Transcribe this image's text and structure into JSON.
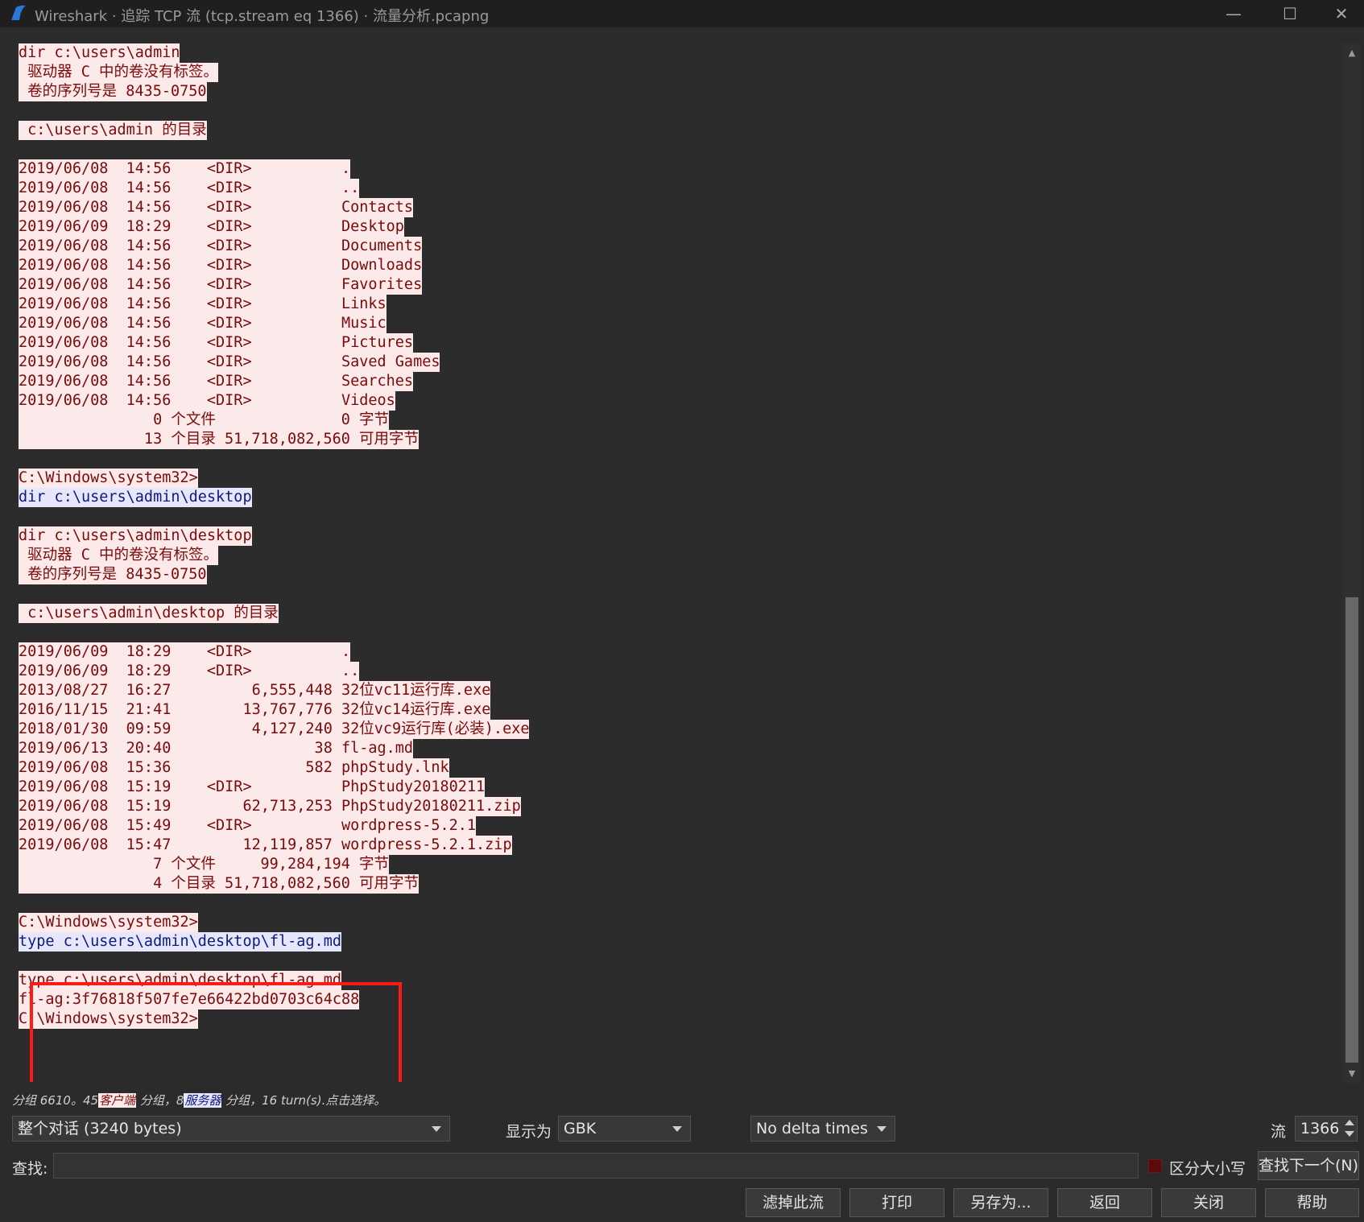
{
  "window": {
    "title": "Wireshark · 追踪 TCP 流 (tcp.stream eq 1366) · 流量分析.pcapng",
    "app_icon": "wireshark-fin-icon",
    "controls": [
      "minimize-icon",
      "maximize-icon",
      "close-icon"
    ]
  },
  "stream": {
    "lines": [
      [
        {
          "role": "client",
          "text": "dir c:\\users\\admin"
        }
      ],
      [
        {
          "role": "client",
          "text": " 驱动器 C 中的卷没有标签。"
        }
      ],
      [
        {
          "role": "client",
          "text": " 卷的序列号是 8435-0750"
        }
      ],
      [],
      [
        {
          "role": "client",
          "text": " c:\\users\\admin 的目录"
        }
      ],
      [],
      [
        {
          "role": "client",
          "text": "2019/06/08  14:56    <DIR>          ."
        }
      ],
      [
        {
          "role": "client",
          "text": "2019/06/08  14:56    <DIR>          .."
        }
      ],
      [
        {
          "role": "client",
          "text": "2019/06/08  14:56    <DIR>          Contacts"
        }
      ],
      [
        {
          "role": "client",
          "text": "2019/06/09  18:29    <DIR>          Desktop"
        }
      ],
      [
        {
          "role": "client",
          "text": "2019/06/08  14:56    <DIR>          Documents"
        }
      ],
      [
        {
          "role": "client",
          "text": "2019/06/08  14:56    <DIR>          Downloads"
        }
      ],
      [
        {
          "role": "client",
          "text": "2019/06/08  14:56    <DIR>          Favorites"
        }
      ],
      [
        {
          "role": "client",
          "text": "2019/06/08  14:56    <DIR>          Links"
        }
      ],
      [
        {
          "role": "client",
          "text": "2019/06/08  14:56    <DIR>          Music"
        }
      ],
      [
        {
          "role": "client",
          "text": "2019/06/08  14:56    <DIR>          Pictures"
        }
      ],
      [
        {
          "role": "client",
          "text": "2019/06/08  14:56    <DIR>          Saved Games"
        }
      ],
      [
        {
          "role": "client",
          "text": "2019/06/08  14:56    <DIR>          Searches"
        }
      ],
      [
        {
          "role": "client",
          "text": "2019/06/08  14:56    <DIR>          Videos"
        }
      ],
      [
        {
          "role": "client",
          "text": "               0 个文件              0 字节"
        }
      ],
      [
        {
          "role": "client",
          "text": "              13 个目录 51,718,082,560 可用字节"
        }
      ],
      [],
      [
        {
          "role": "client",
          "text": "C:\\Windows\\system32>"
        }
      ],
      [
        {
          "role": "server",
          "text": "dir c:\\users\\admin\\desktop"
        }
      ],
      [],
      [
        {
          "role": "client",
          "text": "dir c:\\users\\admin\\desktop"
        }
      ],
      [
        {
          "role": "client",
          "text": " 驱动器 C 中的卷没有标签。"
        }
      ],
      [
        {
          "role": "client",
          "text": " 卷的序列号是 8435-0750"
        }
      ],
      [],
      [
        {
          "role": "client",
          "text": " c:\\users\\admin\\desktop 的目录"
        }
      ],
      [],
      [
        {
          "role": "client",
          "text": "2019/06/09  18:29    <DIR>          ."
        }
      ],
      [
        {
          "role": "client",
          "text": "2019/06/09  18:29    <DIR>          .."
        }
      ],
      [
        {
          "role": "client",
          "text": "2013/08/27  16:27         6,555,448 32位vc11运行库.exe"
        }
      ],
      [
        {
          "role": "client",
          "text": "2016/11/15  21:41        13,767,776 32位vc14运行库.exe"
        }
      ],
      [
        {
          "role": "client",
          "text": "2018/01/30  09:59         4,127,240 32位vc9运行库(必装).exe"
        }
      ],
      [
        {
          "role": "client",
          "text": "2019/06/13  20:40                38 fl-ag.md"
        }
      ],
      [
        {
          "role": "client",
          "text": "2019/06/08  15:36               582 phpStudy.lnk"
        }
      ],
      [
        {
          "role": "client",
          "text": "2019/06/08  15:19    <DIR>          PhpStudy20180211"
        }
      ],
      [
        {
          "role": "client",
          "text": "2019/06/08  15:19        62,713,253 PhpStudy20180211.zip"
        }
      ],
      [
        {
          "role": "client",
          "text": "2019/06/08  15:49    <DIR>          wordpress-5.2.1"
        }
      ],
      [
        {
          "role": "client",
          "text": "2019/06/08  15:47        12,119,857 wordpress-5.2.1.zip"
        }
      ],
      [
        {
          "role": "client",
          "text": "               7 个文件     99,284,194 字节"
        }
      ],
      [
        {
          "role": "client",
          "text": "               4 个目录 51,718,082,560 可用字节"
        }
      ],
      [],
      [
        {
          "role": "client",
          "text": "C:\\Windows\\system32>"
        }
      ],
      [
        {
          "role": "server",
          "text": "type c:\\users\\admin\\desktop\\fl-ag.md"
        }
      ],
      [],
      [
        {
          "role": "client",
          "text": "type c:\\users\\admin\\desktop\\fl-ag.md"
        }
      ],
      [
        {
          "role": "client",
          "text": "fl-ag:3f76818f507fe7e66422bd0703c64c88"
        }
      ],
      [
        {
          "role": "client",
          "text": "C:\\Windows\\system32>"
        }
      ]
    ],
    "highlight_color": "#ff1a1a"
  },
  "summary": {
    "part1": "分组 6610。45",
    "client_label": "客户端",
    "part2": " 分组，8",
    "server_label": "服务器",
    "part3": " 分组，16 turn(s).点击选择。"
  },
  "controls": {
    "conversation_select": "整个对话 (3240 bytes)",
    "show_as_label": "显示为",
    "show_as_select": "GBK",
    "delta_select": "No delta times",
    "stream_label": "流",
    "stream_value": "1366",
    "find_label": "查找:",
    "find_value": "",
    "case_sensitive_label": "区分大小写",
    "find_next_button": "查找下一个(N)"
  },
  "buttons": {
    "filter_out": "滤掉此流",
    "print": "打印",
    "save_as": "另存为...",
    "back": "返回",
    "close": "关闭",
    "help": "帮助"
  },
  "colors": {
    "client_bg": "#fce9e9",
    "client_fg": "#7a0b0b",
    "server_bg": "#e6e7fb",
    "server_fg": "#0e1a7e"
  }
}
